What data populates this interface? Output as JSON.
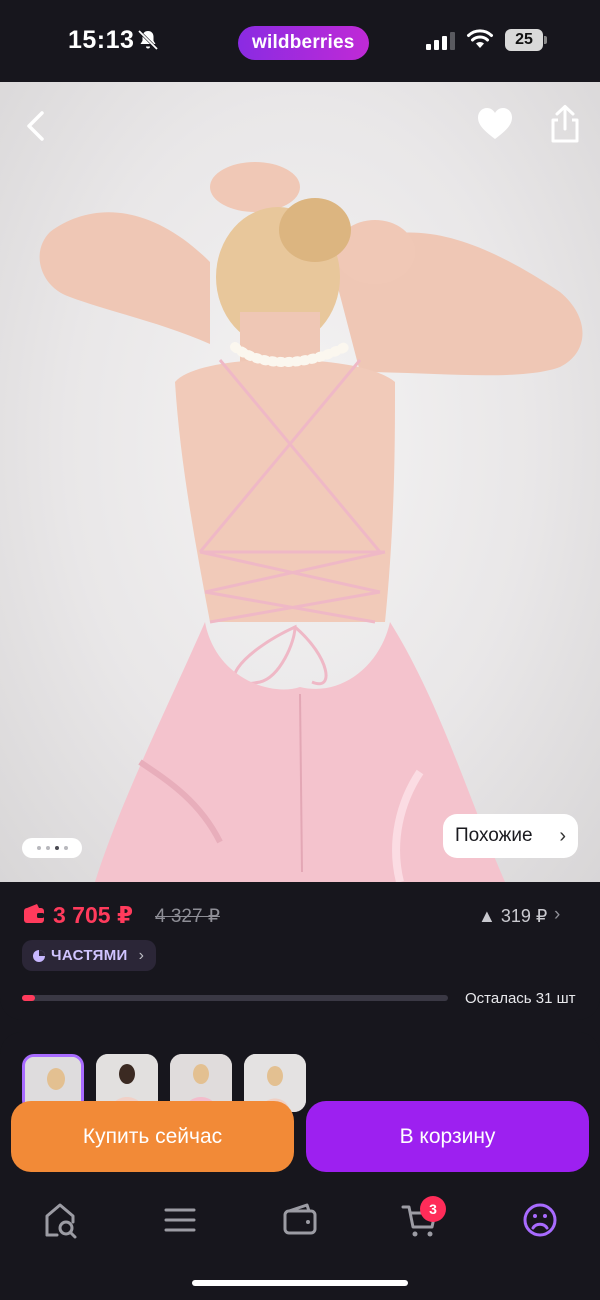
{
  "status_bar": {
    "time": "15:13",
    "brand": "wildberries",
    "battery": "25"
  },
  "product_image": {
    "similar_label": "Похожие",
    "slide_count": 4,
    "active_slide": 3
  },
  "price": {
    "current": "3 705 ₽",
    "old": "4 327 ₽",
    "difference": "▲ 319 ₽",
    "installment_label": "ЧАСТЯМИ"
  },
  "stock": {
    "remaining_text": "Осталась 31 шт",
    "progress_fraction": 0.03
  },
  "thumbnails": [
    {
      "name": "thumb-1",
      "active": true
    },
    {
      "name": "thumb-2",
      "active": false
    },
    {
      "name": "thumb-3",
      "active": false
    },
    {
      "name": "thumb-4",
      "active": false
    }
  ],
  "actions": {
    "buy_now": "Купить сейчас",
    "add_to_cart": "В корзину"
  },
  "bottom_nav": {
    "cart_count": "3"
  },
  "colors": {
    "background": "#17161d",
    "price_red": "#ff3b5c",
    "buy_orange": "#f28a37",
    "cart_purple": "#9d20f0"
  }
}
